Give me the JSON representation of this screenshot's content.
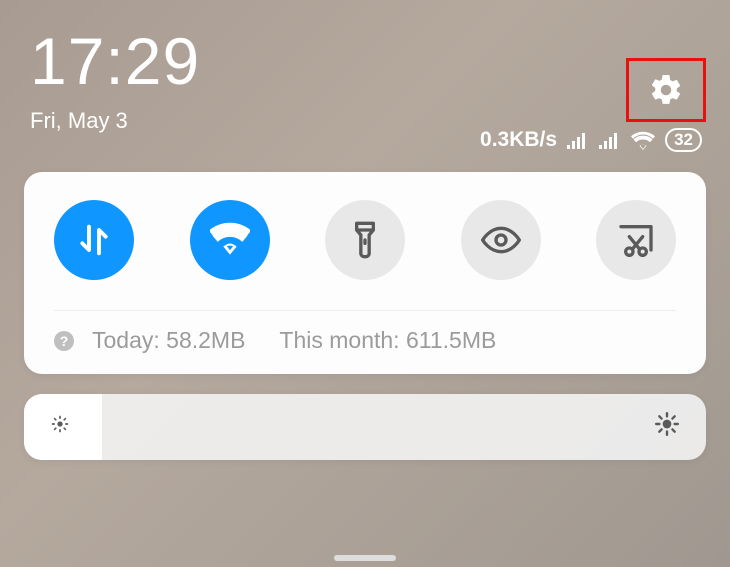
{
  "header": {
    "time": "17:29",
    "date": "Fri, May 3"
  },
  "status": {
    "net_speed": "0.3KB/s",
    "battery": "32"
  },
  "toggles": {
    "data": {
      "name": "mobile-data",
      "active": true
    },
    "wifi": {
      "name": "wifi",
      "active": true
    },
    "flashlight": {
      "name": "flashlight",
      "active": false
    },
    "reading": {
      "name": "reading-mode",
      "active": false
    },
    "screenshot": {
      "name": "screenshot",
      "active": false
    }
  },
  "usage": {
    "today_label": "Today: 58.2MB",
    "month_label": "This month: 611.5MB"
  }
}
